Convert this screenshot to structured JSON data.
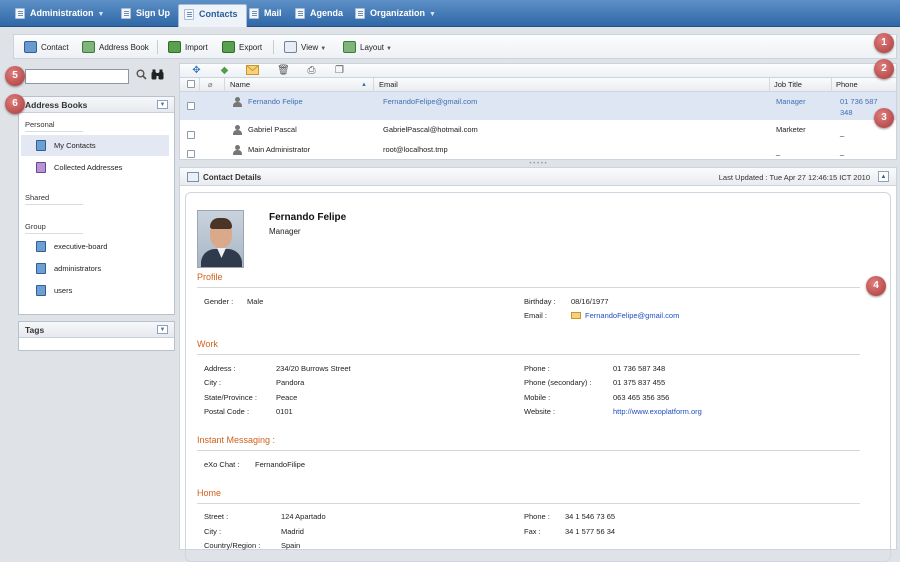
{
  "topnav": {
    "tabs": [
      {
        "label": "Administration",
        "has_menu": true
      },
      {
        "label": "Sign Up",
        "has_menu": false
      },
      {
        "label": "Contacts",
        "has_menu": false,
        "active": true
      },
      {
        "label": "Mail",
        "has_menu": false
      },
      {
        "label": "Agenda",
        "has_menu": false
      },
      {
        "label": "Organization",
        "has_menu": true
      }
    ]
  },
  "toolbar": {
    "contact": "Contact",
    "address_book": "Address Book",
    "import": "Import",
    "export": "Export",
    "view": "View",
    "layout": "Layout"
  },
  "sidebar": {
    "address_books_title": "Address Books",
    "personal_label": "Personal",
    "personal_items": [
      "My Contacts",
      "Collected Addresses"
    ],
    "shared_label": "Shared",
    "group_label": "Group",
    "group_items": [
      "executive-board",
      "administrators",
      "users"
    ],
    "tags_title": "Tags"
  },
  "contact_list": {
    "columns": {
      "name": "Name",
      "email": "Email",
      "job_title": "Job Title",
      "phone": "Phone"
    },
    "rows": [
      {
        "name": "Fernando Felipe",
        "email": "FernandoFelipe@gmail.com",
        "job_title": "Manager",
        "phone_line1": "01 736 587",
        "phone_line2": "348"
      },
      {
        "name": "Gabriel Pascal",
        "email": "GabrielPascal@hotmail.com",
        "job_title": "Marketer",
        "phone_line1": "_",
        "phone_line2": ""
      },
      {
        "name": "Main Administrator",
        "email": "root@localhost.tmp",
        "job_title": "_",
        "phone_line1": "_",
        "phone_line2": ""
      }
    ]
  },
  "details": {
    "title": "Contact Details",
    "last_updated": "Last Updated : Tue Apr 27 12:46:15 ICT 2010",
    "name": "Fernando Felipe",
    "job_title": "Manager",
    "profile": {
      "section": "Profile",
      "gender_label": "Gender :",
      "gender": "Male",
      "birthday_label": "Birthday :",
      "birthday": "08/16/1977",
      "email_label": "Email :",
      "email": "FernandoFelipe@gmail.com"
    },
    "work": {
      "section": "Work",
      "address_label": "Address :",
      "address": "234/20 Burrows Street",
      "city_label": "City :",
      "city": "Pandora",
      "state_label": "State/Province :",
      "state": "Peace",
      "postal_label": "Postal Code :",
      "postal": "0101",
      "phone_label": "Phone :",
      "phone": "01 736 587 348",
      "phone2_label": "Phone (secondary) :",
      "phone2": "01 375 837 455",
      "mobile_label": "Mobile :",
      "mobile": "063 465 356 356",
      "website_label": "Website :",
      "website": "http://www.exoplatform.org"
    },
    "im": {
      "section": "Instant Messaging :",
      "exo_label": "eXo Chat :",
      "exo": "FernandoFilipe"
    },
    "home": {
      "section": "Home",
      "street_label": "Street :",
      "street": "124 Apartado",
      "city_label": "City :",
      "city": "Madrid",
      "country_label": "Country/Region :",
      "country": "Spain",
      "phone_label": "Phone :",
      "phone": "34 1 546 73 65",
      "fax_label": "Fax :",
      "fax": "34 1 577 56 34"
    }
  },
  "callouts": [
    "1",
    "2",
    "3",
    "4",
    "5",
    "6"
  ],
  "colors": {
    "nav": "#3a74b4",
    "section": "#d0611a",
    "link": "#1f4fbf",
    "selected_row": "#dfe6f3",
    "callout": "#b84545"
  }
}
